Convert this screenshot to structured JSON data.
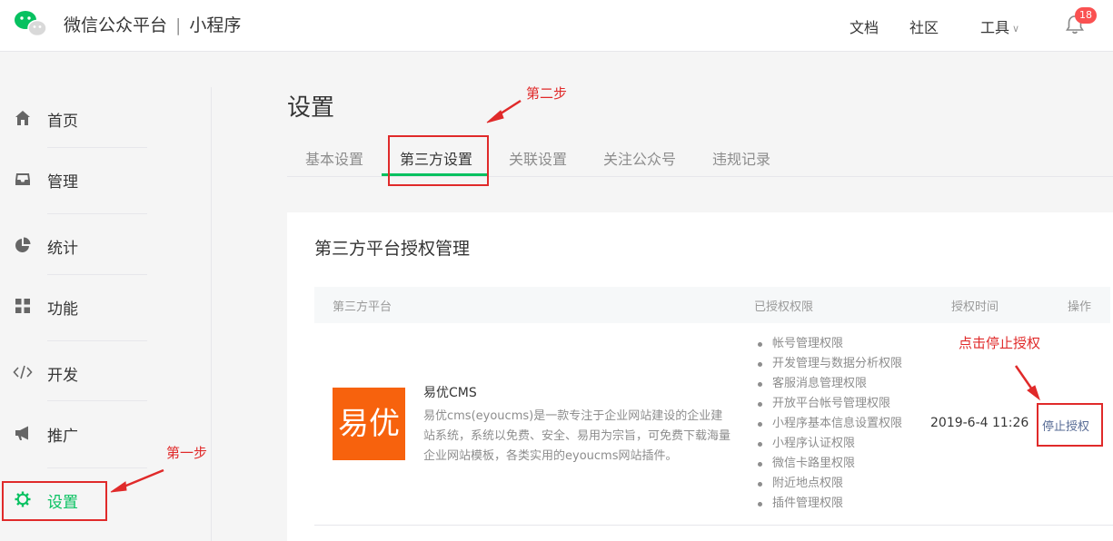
{
  "header": {
    "brand": "微信公众平台",
    "separator": "|",
    "product": "小程序",
    "nav": [
      "文档",
      "社区",
      "工具"
    ],
    "notification_count": "18"
  },
  "sidebar": {
    "items": [
      {
        "label": "首页",
        "icon": "home-icon"
      },
      {
        "label": "管理",
        "icon": "inbox-icon"
      },
      {
        "label": "统计",
        "icon": "pie-chart-icon"
      },
      {
        "label": "功能",
        "icon": "grid-icon"
      },
      {
        "label": "开发",
        "icon": "code-icon"
      },
      {
        "label": "推广",
        "icon": "megaphone-icon"
      },
      {
        "label": "设置",
        "icon": "gear-icon",
        "active": true
      }
    ]
  },
  "main": {
    "title": "设置",
    "tabs": [
      "基本设置",
      "第三方设置",
      "关联设置",
      "关注公众号",
      "违规记录"
    ],
    "active_tab": "第三方设置"
  },
  "card": {
    "title": "第三方平台授权管理",
    "columns": [
      "第三方平台",
      "已授权权限",
      "授权时间",
      "操作"
    ],
    "row": {
      "logo_text": "易优",
      "app_name": "易优CMS",
      "description": "易优cms(eyoucms)是一款专注于企业网站建设的企业建站系统，系统以免费、安全、易用为宗旨，可免费下载海量企业网站模板，各类实用的eyoucms网站插件。",
      "permissions": [
        "帐号管理权限",
        "开发管理与数据分析权限",
        "客服消息管理权限",
        "开放平台帐号管理权限",
        "小程序基本信息设置权限",
        "小程序认证权限",
        "微信卡路里权限",
        "附近地点权限",
        "插件管理权限"
      ],
      "auth_time": "2019-6-4 11:26",
      "action": "停止授权"
    }
  },
  "annotations": {
    "step1": "第一步",
    "step2": "第二步",
    "stop_hint": "点击停止授权"
  },
  "colors": {
    "accent": "#07c160",
    "annotation": "#e02a2a",
    "link": "#576b95",
    "app_logo": "#f7620d",
    "badge": "#fa5151"
  }
}
